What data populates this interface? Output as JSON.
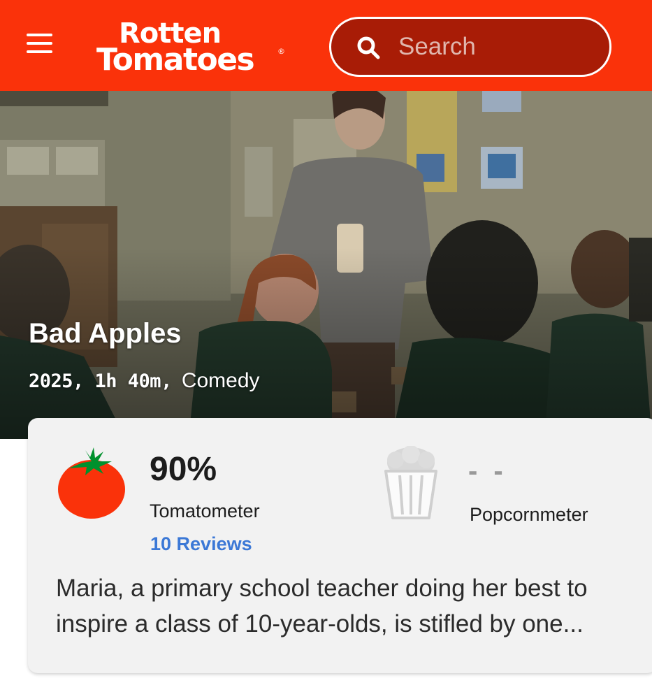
{
  "header": {
    "logo_line1": "Rotten",
    "logo_line2": "Tomatoes",
    "logo_reg": "®",
    "search_placeholder": "Search"
  },
  "hero": {
    "title": "Bad Apples",
    "year_runtime": "2025, 1h 40m,",
    "genre": "Comedy"
  },
  "scores": {
    "tomatometer_score": "90%",
    "tomatometer_label": "Tomatometer",
    "reviews_link": "10 Reviews",
    "popcornmeter_score": "- -",
    "popcornmeter_label": "Popcornmeter"
  },
  "synopsis": "Maria, a primary school teacher doing her best to inspire a class of 10-year-olds, is stifled by one...",
  "colors": {
    "brand": "#fa320a",
    "search_bg": "#a81c06",
    "link": "#3b78d6",
    "tomato": "#fa320a",
    "tomato_leaf": "#00912d"
  },
  "icons": [
    "menu-icon",
    "search-icon",
    "tomato-icon",
    "popcorn-bucket-icon"
  ]
}
